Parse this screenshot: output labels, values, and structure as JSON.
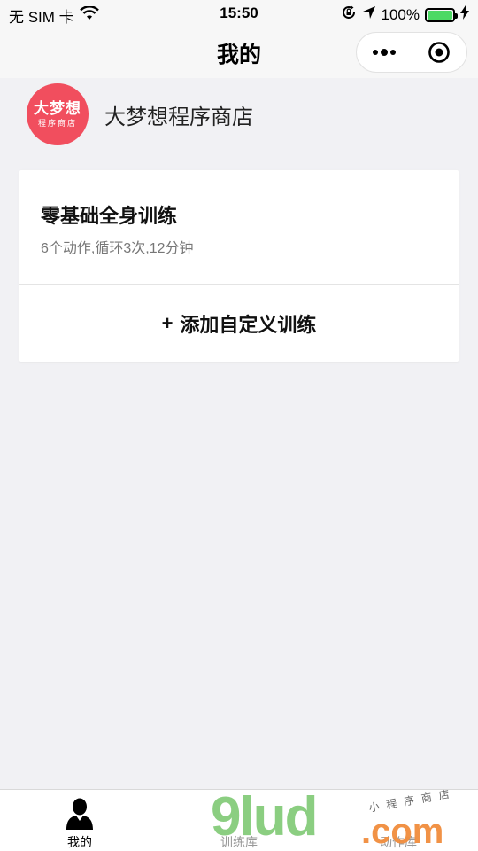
{
  "status_bar": {
    "carrier": "无 SIM 卡",
    "time": "15:50",
    "battery": "100%",
    "battery_level": 1.0
  },
  "nav": {
    "title": "我的"
  },
  "profile": {
    "logo_main": "大梦想",
    "logo_sub": "程序商店",
    "name": "大梦想程序商店"
  },
  "plans": [
    {
      "title": "零基础全身训练",
      "desc": "6个动作,循环3次,12分钟"
    }
  ],
  "add_button": {
    "plus": "+",
    "label": "添加自定义训练"
  },
  "tabs": [
    {
      "label": "我的",
      "active": true
    },
    {
      "label": "训练库",
      "active": false
    },
    {
      "label": "动作库",
      "active": false
    }
  ],
  "watermark": {
    "brand": "9lud",
    "tld": ".com",
    "small": "小程序商店"
  },
  "colors": {
    "accent": "#f14e5e",
    "battery": "#4cd964",
    "background": "#f1f1f4"
  }
}
